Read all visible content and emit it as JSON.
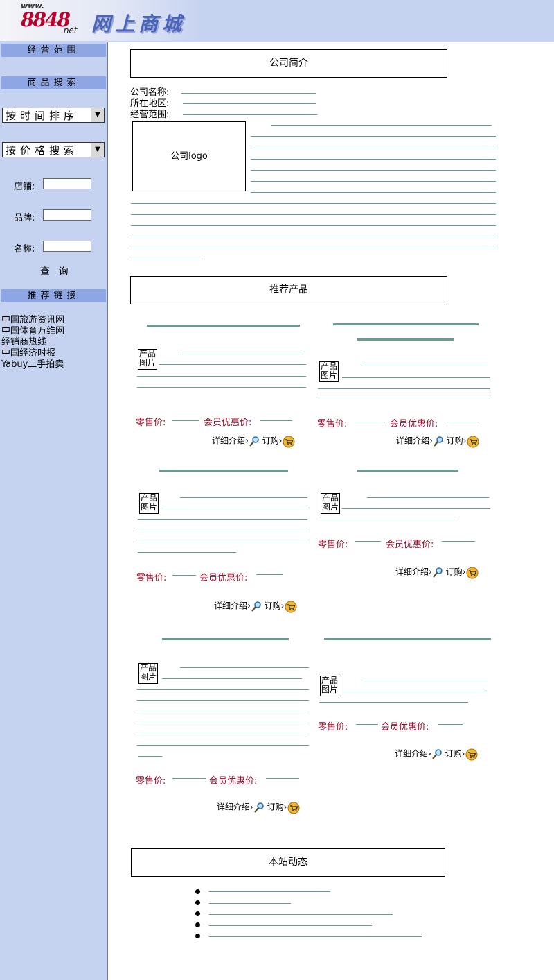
{
  "header": {
    "logo_www": "www.",
    "logo_number": "8848",
    "logo_net": ".net",
    "site_title": "网上商城"
  },
  "sidebar": {
    "business_scope": "经营范围",
    "product_search": "商品搜索",
    "sort_by_time": "按时间排序",
    "search_by_price": "按价格搜索",
    "store_label": "店铺:",
    "brand_label": "品牌:",
    "name_label": "名称:",
    "query_button": "查 询",
    "recommended_links": "推荐链接",
    "links": [
      "中国旅游资讯网",
      "中国体育万维网",
      "经销商热线",
      "中国经济时报",
      "Yabuy二手拍卖"
    ]
  },
  "company": {
    "section_title": "公司简介",
    "name_label": "公司名称:",
    "region_label": "所在地区:",
    "scope_label": "经营范围:",
    "logo_placeholder": "公司logo"
  },
  "products": {
    "section_title": "推荐产品",
    "image_placeholder_line1": "产品",
    "image_placeholder_line2": "图片",
    "retail_price_label": "零售价:",
    "member_price_label": "会员优惠价:",
    "details_label": "详细介绍",
    "order_label": "订购"
  },
  "news": {
    "section_title": "本站动态"
  },
  "colors": {
    "sidebar_bg": "#c5d2f0",
    "sidebar_head_bg": "#8fa6e4",
    "price_red": "#9a0f2f",
    "rule_line": "#6a9a96"
  }
}
